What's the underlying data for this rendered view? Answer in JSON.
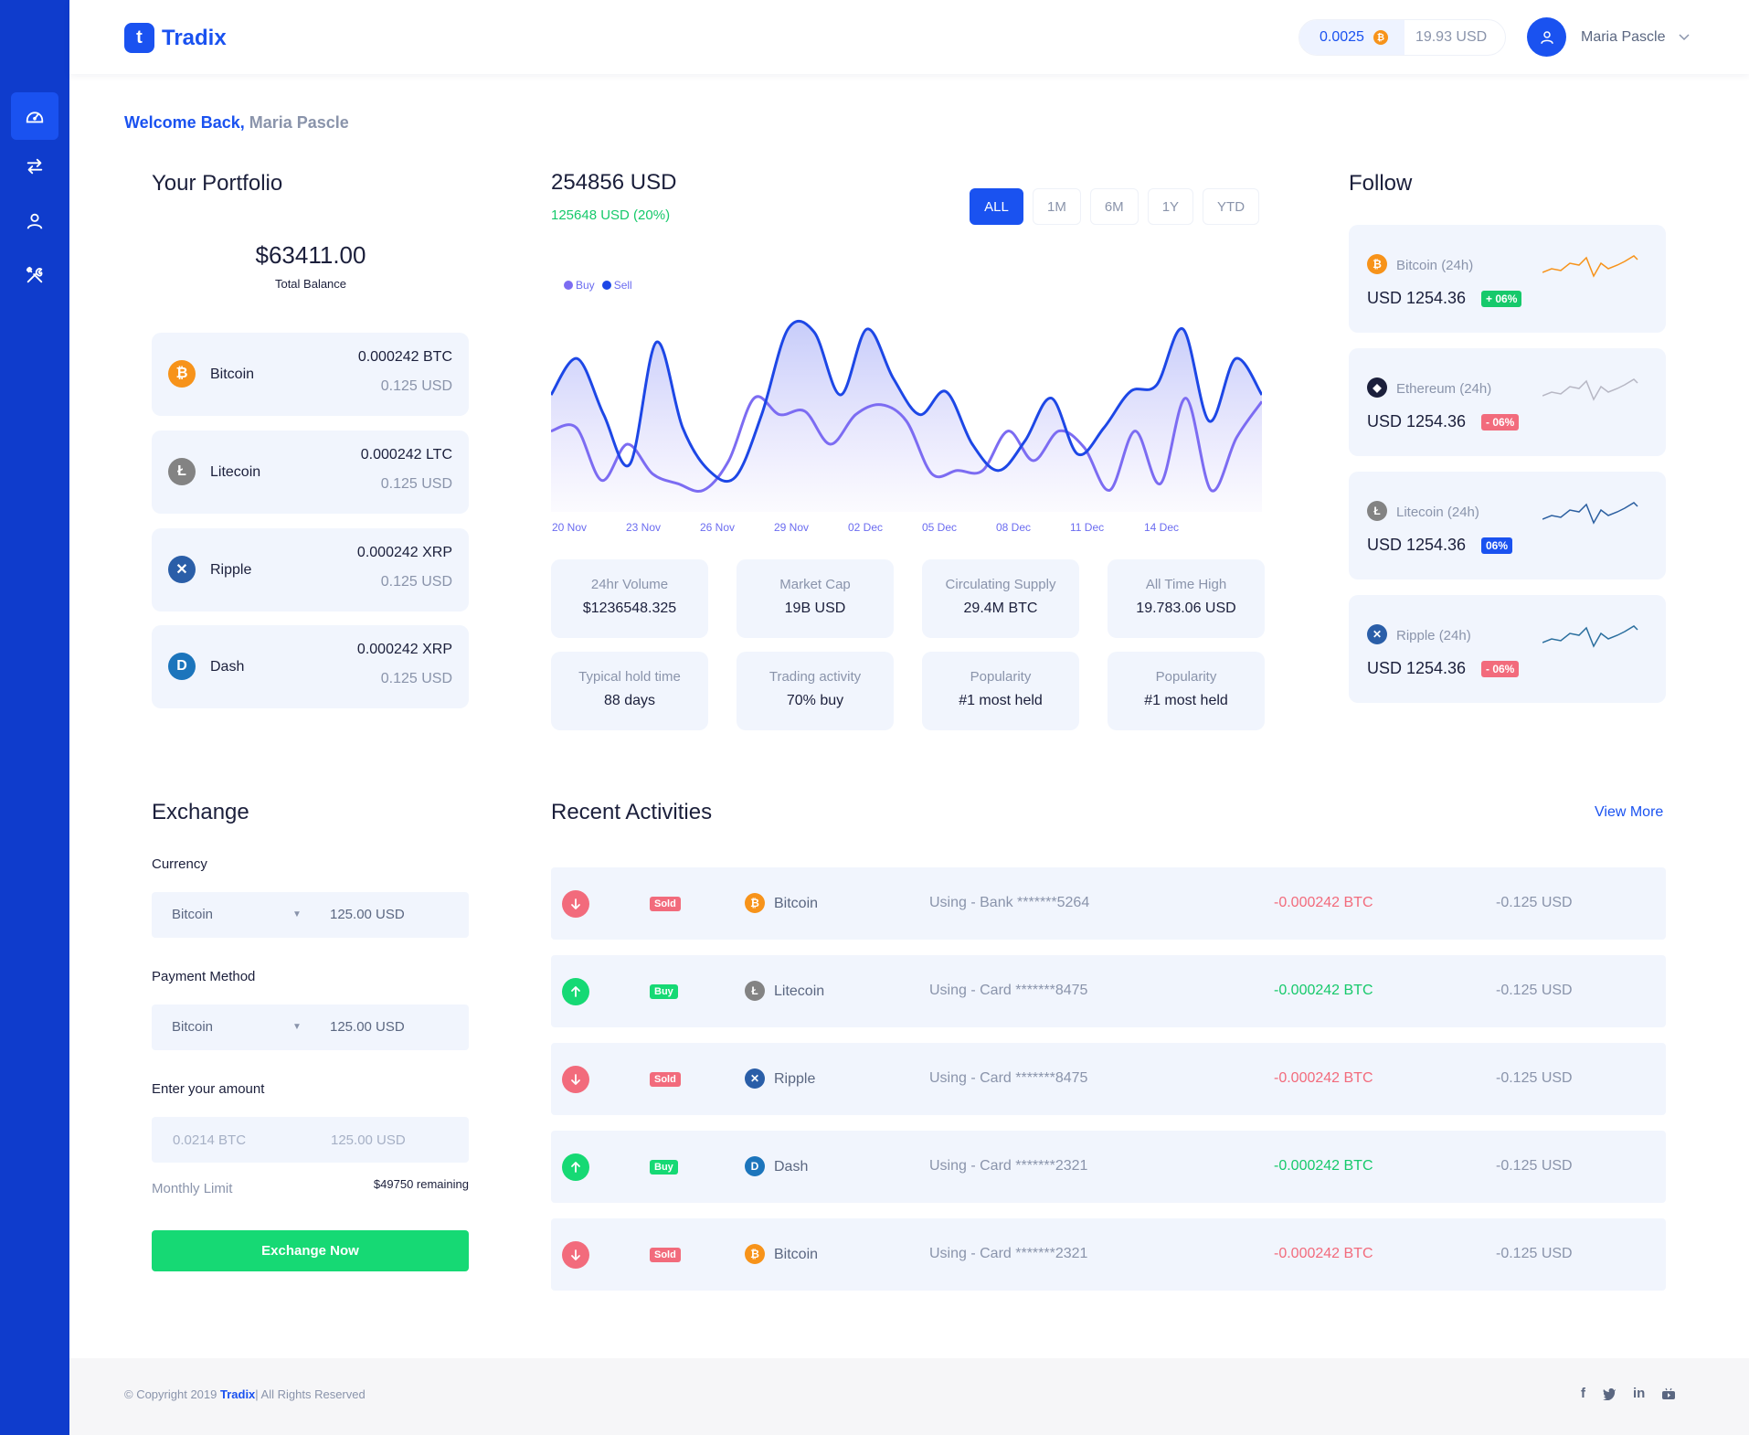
{
  "app": {
    "name": "Tradix",
    "logo_letter": "t"
  },
  "header": {
    "btc_balance": "0.0025",
    "btc_symbol": "₿",
    "usd_balance": "19.93 USD",
    "user_name": "Maria Pascle"
  },
  "sidebar": {
    "items": [
      {
        "icon": "dashboard-icon",
        "active": true
      },
      {
        "icon": "exchange-arrows-icon",
        "active": false
      },
      {
        "icon": "user-icon",
        "active": false
      },
      {
        "icon": "tools-icon",
        "active": false
      }
    ]
  },
  "welcome": {
    "prefix": "Welcome Back,",
    "name": "Maria Pascle"
  },
  "portfolio": {
    "title": "Your Portfolio",
    "total_amount": "$63411.00",
    "total_label": "Total Balance",
    "coins": [
      {
        "name": "Bitcoin",
        "amount": "0.000242 BTC",
        "usd": "0.125 USD",
        "color": "#f7931a",
        "glyph": "₿"
      },
      {
        "name": "Litecoin",
        "amount": "0.000242 LTC",
        "usd": "0.125 USD",
        "color": "#838383",
        "glyph": "Ł"
      },
      {
        "name": "Ripple",
        "amount": "0.000242 XRP",
        "usd": "0.125 USD",
        "color": "#2a5ea8",
        "glyph": "✕"
      },
      {
        "name": "Dash",
        "amount": "0.000242 XRP",
        "usd": "0.125 USD",
        "color": "#1c75bc",
        "glyph": "D"
      }
    ]
  },
  "overview": {
    "amount": "254856 USD",
    "change": "125648 USD (20%)",
    "ranges": [
      "ALL",
      "1M",
      "6M",
      "1Y",
      "YTD"
    ],
    "active_range": "ALL",
    "legend": {
      "buy": "Buy",
      "sell": "Sell"
    },
    "colors": {
      "buy": "#7c6cf2",
      "sell": "#1d47e6"
    }
  },
  "chart_data": {
    "type": "area",
    "title": "",
    "x": [
      "20 Nov",
      "23 Nov",
      "26 Nov",
      "29 Nov",
      "02 Dec",
      "05 Dec",
      "08 Dec",
      "11 Dec",
      "14 Dec"
    ],
    "x_ticks": [
      "20 Nov",
      "23 Nov",
      "26 Nov",
      "29 Nov",
      "02 Dec",
      "05 Dec",
      "08 Dec",
      "11 Dec",
      "14 Dec"
    ],
    "ylim": [
      0,
      100
    ],
    "series": [
      {
        "name": "Sell",
        "color": "#1d47e6",
        "values": [
          60,
          82,
          48,
          18,
          92,
          40,
          14,
          10,
          48,
          100,
          98,
          60,
          100,
          70,
          48,
          62,
          30,
          14,
          32,
          58,
          24,
          40,
          62,
          66,
          100,
          44,
          82,
          60
        ]
      },
      {
        "name": "Buy",
        "color": "#7c6cf2",
        "values": [
          38,
          40,
          8,
          30,
          12,
          6,
          2,
          20,
          58,
          48,
          50,
          30,
          48,
          54,
          44,
          12,
          14,
          14,
          38,
          20,
          38,
          28,
          2,
          38,
          6,
          58,
          2,
          34,
          56
        ]
      }
    ]
  },
  "stats": [
    {
      "label": "24hr Volume",
      "value": "$1236548.325"
    },
    {
      "label": "Market Cap",
      "value": "19B USD"
    },
    {
      "label": "Circulating Supply",
      "value": "29.4M BTC"
    },
    {
      "label": "All Time High",
      "value": "19.783.06 USD"
    },
    {
      "label": "Typical hold time",
      "value": "88 days"
    },
    {
      "label": "Trading activity",
      "value": "70% buy"
    },
    {
      "label": "Popularity",
      "value": "#1 most held"
    },
    {
      "label": "Popularity",
      "value": "#1 most held"
    }
  ],
  "follow": {
    "title": "Follow",
    "items": [
      {
        "name": "Bitcoin (24h)",
        "price": "USD 1254.36",
        "badge": "+ 06%",
        "badge_color": "#16c96b",
        "icon_color": "#f7931a",
        "glyph": "₿",
        "spark_color": "#f7931a"
      },
      {
        "name": "Ethereum (24h)",
        "price": "USD 1254.36",
        "badge": "- 06%",
        "badge_color": "#f26b7c",
        "icon_color": "#1b1f3b",
        "glyph": "◆",
        "spark_color": "#b7b7c4"
      },
      {
        "name": "Litecoin (24h)",
        "price": "USD 1254.36",
        "badge": "06%",
        "badge_color": "#1a52f0",
        "icon_color": "#838383",
        "glyph": "Ł",
        "spark_color": "#2b5fa0"
      },
      {
        "name": "Ripple (24h)",
        "price": "USD 1254.36",
        "badge": "- 06%",
        "badge_color": "#f26b7c",
        "icon_color": "#2a5ea8",
        "glyph": "✕",
        "spark_color": "#2b6f9e"
      }
    ]
  },
  "exchange": {
    "title": "Exchange",
    "currency_label": "Currency",
    "currency_value": "Bitcoin",
    "currency_amount": "125.00 USD",
    "payment_label": "Payment Method",
    "payment_value": "Bitcoin",
    "payment_amount": "125.00 USD",
    "amount_label": "Enter your amount",
    "amount_btc_placeholder": "0.0214 BTC",
    "amount_usd_placeholder": "125.00 USD",
    "limit_label": "Monthly Limit",
    "limit_value": "$49750 remaining",
    "button": "Exchange Now"
  },
  "activities": {
    "title": "Recent Activities",
    "view_more": "View More",
    "rows": [
      {
        "dir": "down",
        "badge": "Sold",
        "coin": "Bitcoin",
        "coin_color": "#f7931a",
        "glyph": "₿",
        "method": "Using - Bank *******5264",
        "amount": "-0.000242 BTC",
        "usd": "-0.125 USD"
      },
      {
        "dir": "up",
        "badge": "Buy",
        "coin": "Litecoin",
        "coin_color": "#838383",
        "glyph": "Ł",
        "method": "Using - Card *******8475",
        "amount": "-0.000242 BTC",
        "usd": "-0.125 USD"
      },
      {
        "dir": "down",
        "badge": "Sold",
        "coin": "Ripple",
        "coin_color": "#2a5ea8",
        "glyph": "✕",
        "method": "Using - Card *******8475",
        "amount": "-0.000242 BTC",
        "usd": "-0.125 USD"
      },
      {
        "dir": "up",
        "badge": "Buy",
        "coin": "Dash",
        "coin_color": "#1c75bc",
        "glyph": "D",
        "method": "Using - Card *******2321",
        "amount": "-0.000242 BTC",
        "usd": "-0.125 USD"
      },
      {
        "dir": "down",
        "badge": "Sold",
        "coin": "Bitcoin",
        "coin_color": "#f7931a",
        "glyph": "₿",
        "method": "Using - Card *******2321",
        "amount": "-0.000242 BTC",
        "usd": "-0.125 USD"
      }
    ],
    "colors": {
      "down": "#f26b7c",
      "up": "#16d974"
    }
  },
  "footer": {
    "copyright_prefix": "© Copyright 2019",
    "brand": "Tradix",
    "copyright_suffix": "| All Rights Reserved",
    "socials": [
      "f",
      "t",
      "in",
      "yt"
    ]
  }
}
